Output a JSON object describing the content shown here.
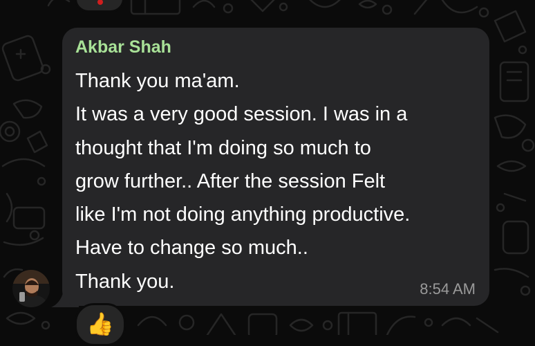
{
  "message": {
    "sender": "Akbar Shah",
    "lines": [
      "Thank you ma'am.",
      "It was a very good session. I was in a",
      "thought that I'm doing so much to",
      "grow further.. After the session Felt",
      "like I'm not doing anything productive.",
      "Have to change so much..",
      "Thank you."
    ],
    "time": "8:54 AM"
  },
  "reaction": {
    "emoji": "👍",
    "icon": "thumbs-up-icon"
  },
  "theme": {
    "background": "#0b0b0b",
    "bubble": "#262628",
    "sender_color": "#a8e197",
    "text_color": "#ffffff",
    "time_color": "#9a9a9a"
  }
}
